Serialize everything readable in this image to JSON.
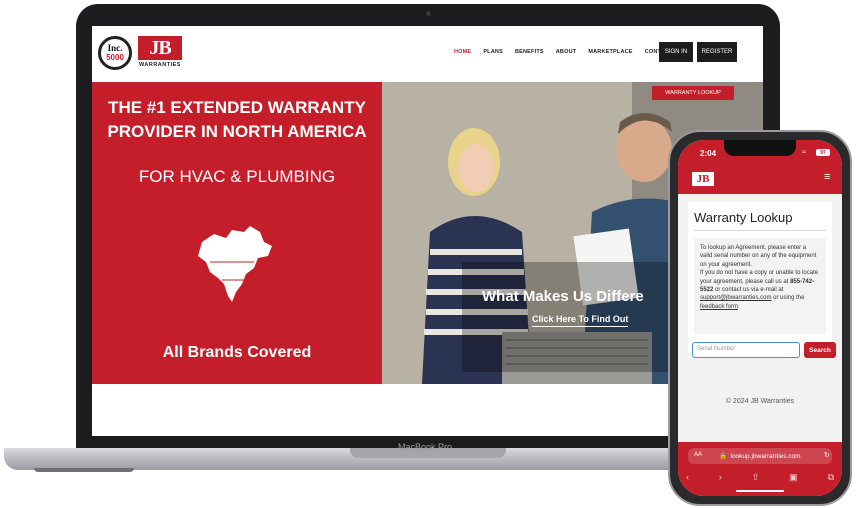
{
  "laptop": {
    "model_label": "MacBook Pro"
  },
  "site": {
    "inc_badge": {
      "top": "Inc.",
      "bottom": "5000"
    },
    "logo": {
      "mark": "JB",
      "word": "WARRANTIES"
    },
    "nav": [
      {
        "label": "HOME",
        "active": true
      },
      {
        "label": "PLANS",
        "active": false
      },
      {
        "label": "BENEFITS",
        "active": false
      },
      {
        "label": "ABOUT",
        "active": false
      },
      {
        "label": "MARKETPLACE",
        "active": false
      },
      {
        "label": "CONTACT",
        "active": false
      }
    ],
    "sign_in": "SIGN IN",
    "register": "REGISTER",
    "warranty_lookup_tag": "WARRANTY LOOKUP",
    "hero": {
      "headline": "THE #1 EXTENDED WARRANTY PROVIDER IN NORTH AMERICA",
      "subline": "FOR HVAC & PLUMBING",
      "brands": "All Brands Covered",
      "photo_title": "What Makes Us Differe",
      "photo_link": "Click Here To Find Out"
    },
    "accent_color": "#c41e2a"
  },
  "phone": {
    "time": "2:04",
    "battery": "97",
    "logo": "JB",
    "title": "Warranty Lookup",
    "info": {
      "line1": "To lookup an Agreement, please enter a valid serial number on any of the equipment on your agreement.",
      "line2_pre": "If you do not have a copy or unable to locate your agreement, please call us at",
      "phone_number": "855-742-5522",
      "line2_mid": "or contact us via e-mail at",
      "email": "support@jbwarranties.com",
      "line2_post": "or using the",
      "feedback_link": "feedback form",
      "end": "."
    },
    "search_placeholder": "Serial Number",
    "search_button": "Search",
    "copyright": "© 2024 JB Warranties",
    "text_size": "AA",
    "url": "lookup.jbwarranties.com"
  }
}
